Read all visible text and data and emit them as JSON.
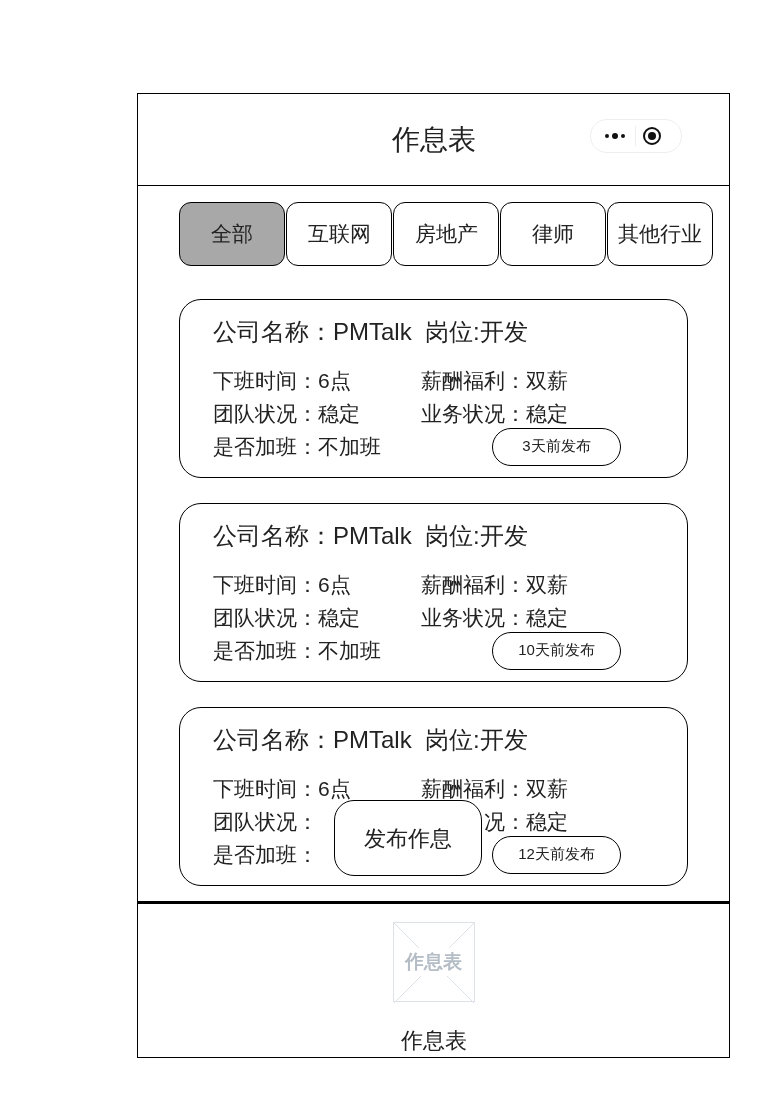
{
  "header": {
    "title": "作息表"
  },
  "tabs": [
    {
      "label": "全部",
      "selected": true
    },
    {
      "label": "互联网",
      "selected": false
    },
    {
      "label": "房地产",
      "selected": false
    },
    {
      "label": "律师",
      "selected": false
    },
    {
      "label": "其他行业",
      "selected": false
    }
  ],
  "cards": [
    {
      "title": "公司名称：PMTalk  岗位:开发",
      "rows": [
        [
          "下班时间：6点",
          "薪酬福利：双薪"
        ],
        [
          "团队状况：稳定",
          "业务状况：稳定"
        ],
        [
          "是否加班：不加班"
        ]
      ],
      "posted": "3天前发布"
    },
    {
      "title": "公司名称：PMTalk  岗位:开发",
      "rows": [
        [
          "下班时间：6点",
          "薪酬福利：双薪"
        ],
        [
          "团队状况：稳定",
          "业务状况：稳定"
        ],
        [
          "是否加班：不加班"
        ]
      ],
      "posted": "10天前发布"
    },
    {
      "title": "公司名称：PMTalk  岗位:开发",
      "rows": [
        [
          "下班时间：6点",
          "薪酬福利：双薪"
        ],
        [
          "团队状况：",
          "况：稳定"
        ],
        [
          "是否加班："
        ]
      ],
      "posted": "12天前发布"
    }
  ],
  "floating_button": {
    "label": "发布作息"
  },
  "footer": {
    "image_text": "作息表",
    "label": "作息表"
  }
}
